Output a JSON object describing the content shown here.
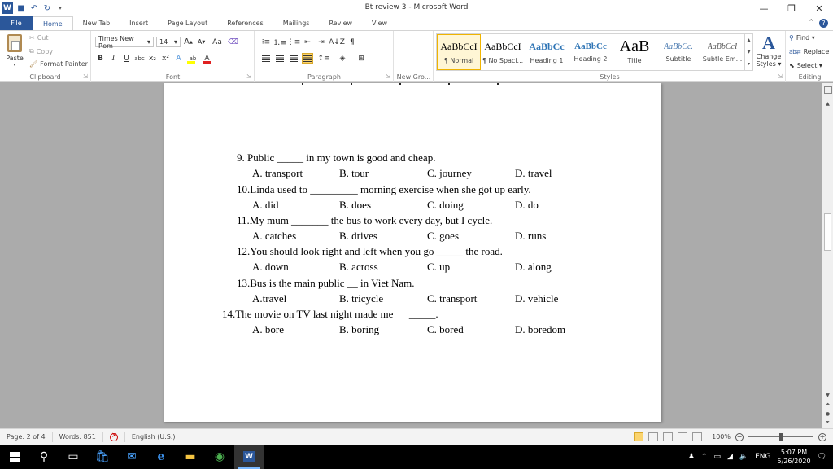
{
  "window": {
    "title": "Bt review 3  -  Microsoft Word",
    "minimize": "—",
    "restore": "❐",
    "close": "✕"
  },
  "tabs": [
    {
      "label": "File"
    },
    {
      "label": "Home"
    },
    {
      "label": "New Tab"
    },
    {
      "label": "Insert"
    },
    {
      "label": "Page Layout"
    },
    {
      "label": "References"
    },
    {
      "label": "Mailings"
    },
    {
      "label": "Review"
    },
    {
      "label": "View"
    }
  ],
  "ribbon": {
    "clipboard": {
      "label": "Clipboard",
      "paste": "Paste",
      "cut": "Cut",
      "copy": "Copy",
      "format_painter": "Format Painter"
    },
    "font": {
      "label": "Font",
      "font_name": "Times New Rom",
      "font_size": "14",
      "grow": "A",
      "shrink": "A",
      "case": "Aa",
      "bold": "B",
      "italic": "I",
      "underline": "U",
      "strike": "abc",
      "subscript": "x₂",
      "superscript": "x²",
      "text_effects": "A",
      "highlight": "ab",
      "font_color": "A"
    },
    "paragraph": {
      "label": "Paragraph",
      "pilcrow": "¶",
      "sort": "A↓Z"
    },
    "new_group": {
      "label": "New Gro..."
    },
    "styles": {
      "label": "Styles",
      "items": [
        {
          "sample": "AaBbCcI",
          "name": "¶ Normal"
        },
        {
          "sample": "AaBbCcI",
          "name": "¶ No Spaci..."
        },
        {
          "sample": "AaBbCc",
          "name": "Heading 1"
        },
        {
          "sample": "AaBbCc",
          "name": "Heading 2"
        },
        {
          "sample": "AaB",
          "name": "Title"
        },
        {
          "sample": "AaBbCc.",
          "name": "Subtitle"
        },
        {
          "sample": "AaBbCcI",
          "name": "Subtle Em..."
        }
      ],
      "change_styles_1": "Change",
      "change_styles_2": "Styles ▾"
    },
    "editing": {
      "label": "Editing",
      "find": "Find ▾",
      "replace": "Replace",
      "select": "Select ▾"
    }
  },
  "document": {
    "questions": [
      {
        "stem": "9. Public _____ in my town is good and cheap.",
        "options": [
          "A. transport",
          "B. tour",
          "C. journey",
          "D. travel"
        ]
      },
      {
        "stem": "10.Linda used to _________ morning exercise when she got up early.",
        "options": [
          "A. did",
          "B. does",
          "C. doing",
          "D. do"
        ]
      },
      {
        "stem": "11.My mum _______ the bus to work every day, but I cycle.",
        "options": [
          "A. catches",
          "B. drives",
          "C. goes",
          "D. runs"
        ]
      },
      {
        "stem": "12.You should look right and left when you go _____ the road.",
        "options": [
          "A. down",
          "B. across",
          "C. up",
          "D. along"
        ]
      },
      {
        "stem": "13.Bus is the main public __ in Viet Nam.",
        "options": [
          "A.travel",
          "B. tricycle",
          "C. transport",
          "D. vehicle"
        ]
      },
      {
        "stem": "14.The movie on TV last night made me      _____.",
        "options": [
          "A. bore",
          "B. boring",
          "C. bored",
          "D. boredom"
        ]
      }
    ]
  },
  "status": {
    "page": "Page: 2 of 4",
    "words": "Words: 851",
    "language": "English (U.S.)",
    "zoom": "100%"
  },
  "taskbar": {
    "language": "ENG",
    "time": "5:07 PM",
    "date": "5/26/2020"
  },
  "colors": {
    "word_blue": "#2b579a",
    "highlight_yellow": "#fbd46e",
    "font_color_red": "#e02020"
  }
}
